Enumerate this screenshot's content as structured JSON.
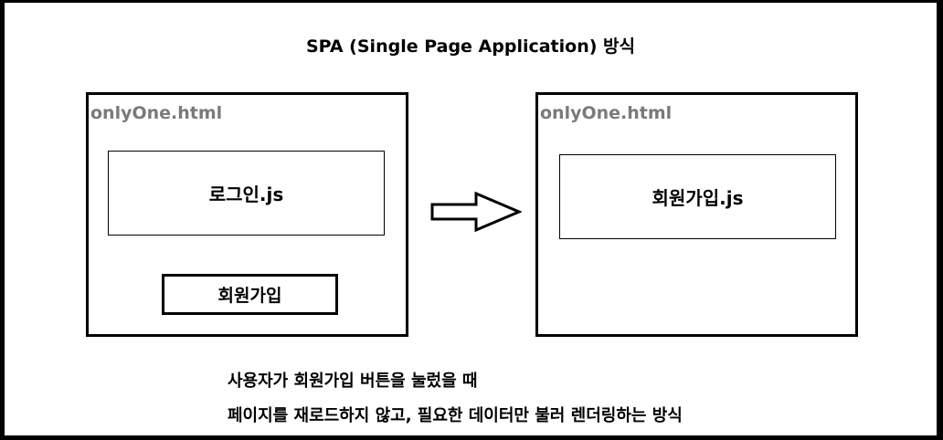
{
  "title": "SPA (Single Page Application) 방식",
  "left_page": {
    "file_label": "onlyOne.html",
    "component": "로그인.js",
    "button_label": "회원가입"
  },
  "right_page": {
    "file_label": "onlyOne.html",
    "component": "회원가입.js"
  },
  "caption": {
    "line1": "사용자가 회원가입 버튼을 눌렀을 때",
    "line2": "페이지를 재로드하지 않고, 필요한 데이터만 불러 렌더링하는 방식"
  }
}
